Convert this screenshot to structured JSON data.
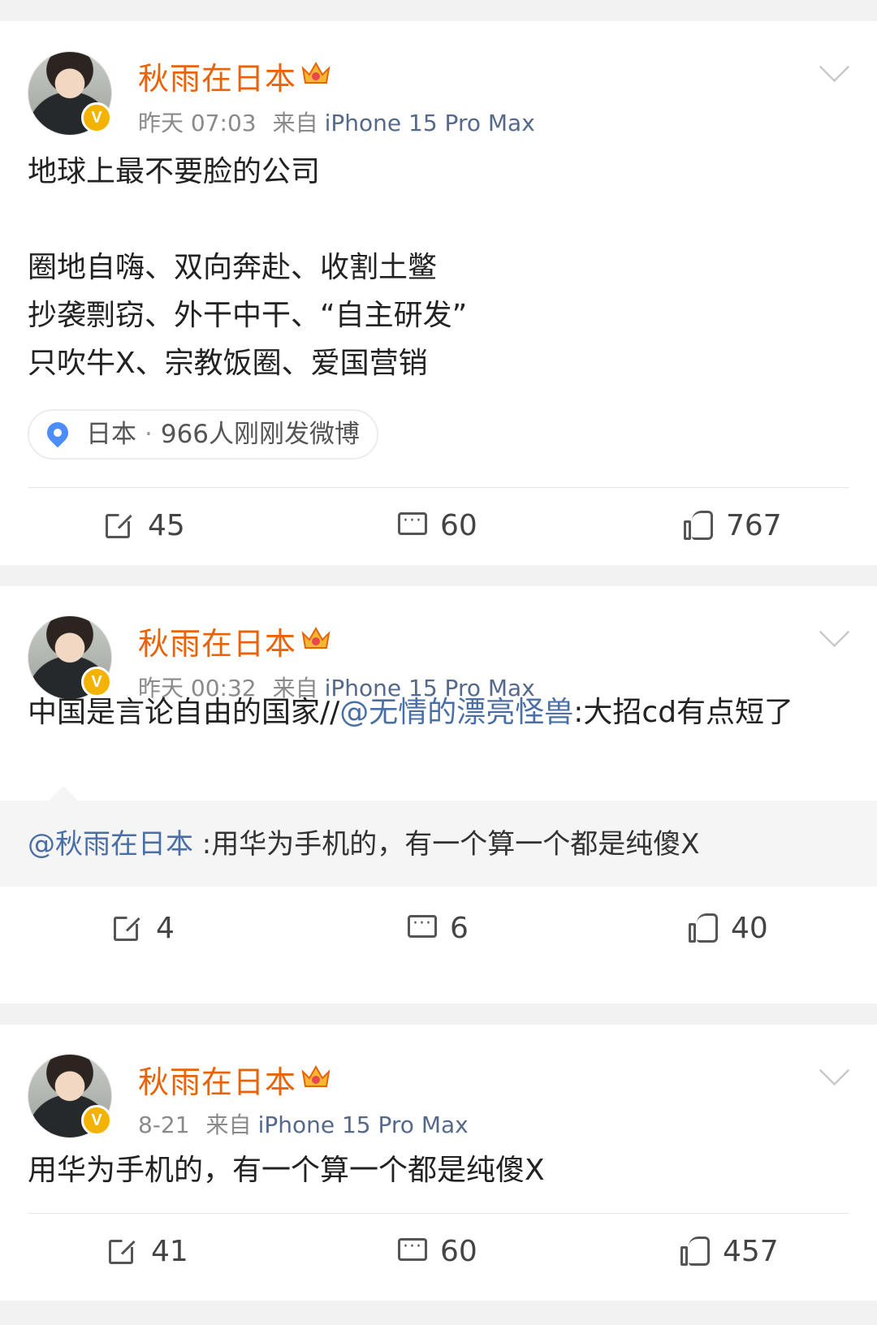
{
  "posts": [
    {
      "author": "秋雨在日本",
      "time": "昨天 07:03",
      "source_label": "来自",
      "device": "iPhone 15 Pro Max",
      "lines": [
        "地球上最不要脸的公司",
        "",
        "圈地自嗨、双向奔赴、收割土鳖",
        "抄袭剽窃、外干中干、“自主研发”",
        "只吹牛X、宗教饭圈、爱国营销"
      ],
      "location": {
        "place": "日本",
        "separator": "·",
        "info": "966人刚刚发微博"
      },
      "stats": {
        "reposts": "45",
        "comments": "60",
        "likes": "767"
      }
    },
    {
      "author": "秋雨在日本",
      "time": "昨天 00:32",
      "source_label": "来自",
      "device": "iPhone 15 Pro Max",
      "text_before": "中国是言论自由的国家//",
      "mention": "@无情的漂亮怪兽",
      "text_after": ":大招cd有点短了",
      "repost": {
        "mention": "@秋雨在日本",
        "text": " :用华为手机的，有一个算一个都是纯傻X"
      },
      "stats": {
        "reposts": "4",
        "comments": "6",
        "likes": "40"
      }
    },
    {
      "author": "秋雨在日本",
      "time": "8-21",
      "source_label": "来自",
      "device": "iPhone 15 Pro Max",
      "text": "用华为手机的，有一个算一个都是纯傻X",
      "stats": {
        "reposts": "41",
        "comments": "60",
        "likes": "457"
      }
    }
  ],
  "verified_badge": "V",
  "colors": {
    "author": "#e8630a",
    "mention": "#4a6fa5",
    "device": "#55698a",
    "badge": "#f3b300",
    "pin": "#4c8dfa"
  },
  "icons": [
    "crown-icon",
    "chevron-down-icon",
    "location-pin-icon",
    "share-icon",
    "comment-icon",
    "like-icon"
  ]
}
